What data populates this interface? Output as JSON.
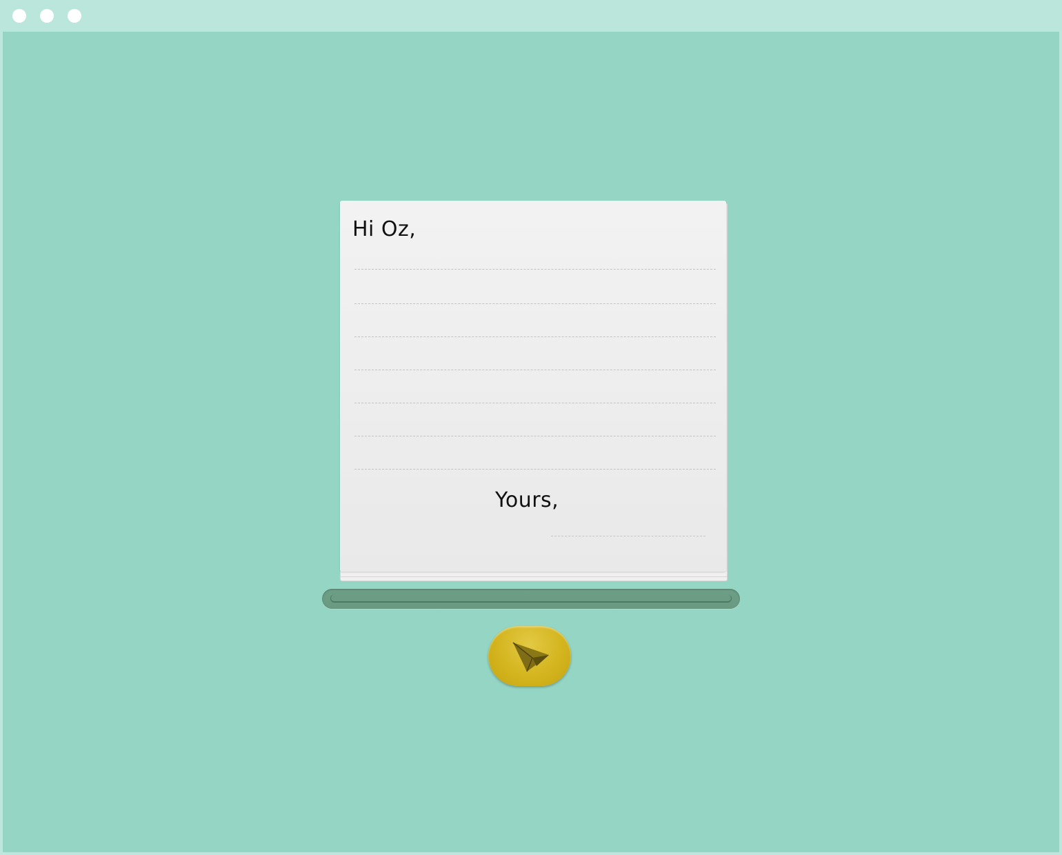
{
  "window": {
    "controls": [
      "close",
      "minimize",
      "zoom"
    ]
  },
  "letter": {
    "greeting": "Hi Oz,",
    "closing": "Yours,",
    "body_lines": 7
  },
  "send_button": {
    "icon": "paper-plane-icon"
  },
  "colors": {
    "background": "#94d5c4",
    "titlebar": "#bae6db",
    "paper": "#f0f0f0",
    "slot": "#6d9e86",
    "button": "#d4b51f"
  }
}
